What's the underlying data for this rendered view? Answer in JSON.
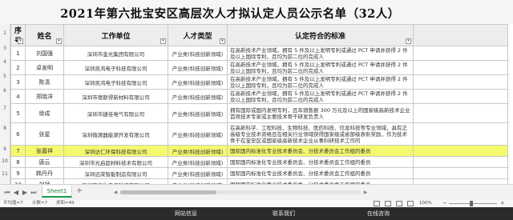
{
  "title": "2021年第六批宝安区高层次人才拟认定人员公示名单（32人）",
  "headers": [
    "序号",
    "姓名",
    "工作单位",
    "人才类型",
    "认定符合的标准"
  ],
  "gutter": [
    "1",
    "2",
    "3",
    "4",
    "5",
    "6",
    "7",
    "8",
    "9",
    "10",
    "11",
    "12",
    "13"
  ],
  "rows": [
    {
      "num": "1",
      "name": "刘国强",
      "unit": "深圳市金光集团有限公司",
      "type": "产业类(科技创新领域)",
      "req": "在高新技术产业领域，拥有 5 件及以上发明专利或通过 PCT 申请并获得 2 件及以上国际专利，且均为前二位的完成人"
    },
    {
      "num": "2",
      "name": "卓发明",
      "unit": "深圳凯鸿电子科技有限公司",
      "type": "产业类(科技创新领域)",
      "req": "在高新技术产业领域，拥有 5 件及以上发明专利或通过 PCT 申请并获得 2 件及以上国际专利，且均为前二位的完成人"
    },
    {
      "num": "3",
      "name": "陈清",
      "unit": "深圳凯鸿电子科技有限公司",
      "type": "产业类(科技创新领域)",
      "req": "在高新技术产业领域，拥有 5 件及以上发明专利或通过 PCT 申请并获得 2 件及以上国际专利，且均为前二位的完成人"
    },
    {
      "num": "4",
      "name": "郑晓洋",
      "unit": "深圳市德斯得新材料有限公司",
      "type": "产业类(科技创新领域)",
      "req": "在高新技术产业领域，拥有 5 件及以上发明专利或通过 PCT 申请并获得 2 件及以上国际专利，且均为前二位的完成人"
    },
    {
      "num": "5",
      "name": "徐成",
      "unit": "深圳市捷佳电气有限公司",
      "type": "产业类(科技创新领域)",
      "req": "拥有国际或国内发明专利，且年销售额 300 万元及以上的国家级高新技术企业首席技术专家或主要技术骨干研发负责人"
    },
    {
      "num": "6",
      "name": "张星",
      "unit": "深圳微源器能源开发有限公司",
      "type": "产业类(科技创新领域)",
      "req": "在高新科学、工程科技、生物科技、医药科技、信息科技等专业领域，具有正高级专业技术资格且在相关行业领域获得国家级或省部级表彰奖励，作为技术骨干在宝安区或国家级高新技术企业从事科研技术工作的"
    },
    {
      "num": "7",
      "name": "张嘉祥",
      "unit": "深圳达仁环保科技有限公司",
      "type": "产业类(科技创新领域)",
      "req": "国际国内标准化专业技术委员会、分技术委员会工作组的委员"
    },
    {
      "num": "8",
      "name": "唐云",
      "unit": "深圳市光启超材料技术有限公司",
      "type": "产业类(科技创新领域)",
      "req": "国际国内标准化专业技术委员会、分技术委员会工作组的委员"
    },
    {
      "num": "9",
      "name": "韩丹丹",
      "unit": "深圳远荣智能制造有限公司",
      "type": "产业类(科技创新领域)",
      "req": "国际国内标准化专业技术委员会、分技术委员会工作组的委员"
    },
    {
      "num": "10",
      "name": "刘斌",
      "unit": "深圳市仁生电子科技有限公司",
      "type": "产业类(科技创新领域)",
      "req": "国际国内标准化专业技术委员会、分技术委员会工作组的委员"
    }
  ],
  "tabs": {
    "sheet": "Sheet1",
    "add": "+"
  },
  "status": {
    "sum": "平均值=7",
    "count": "计数=7",
    "total": "求和=49",
    "zoom": "100%",
    "zoom_minus": "−",
    "zoom_plus": "+"
  },
  "webbar": [
    "网站信息",
    "联系我们",
    "在线咨询"
  ]
}
